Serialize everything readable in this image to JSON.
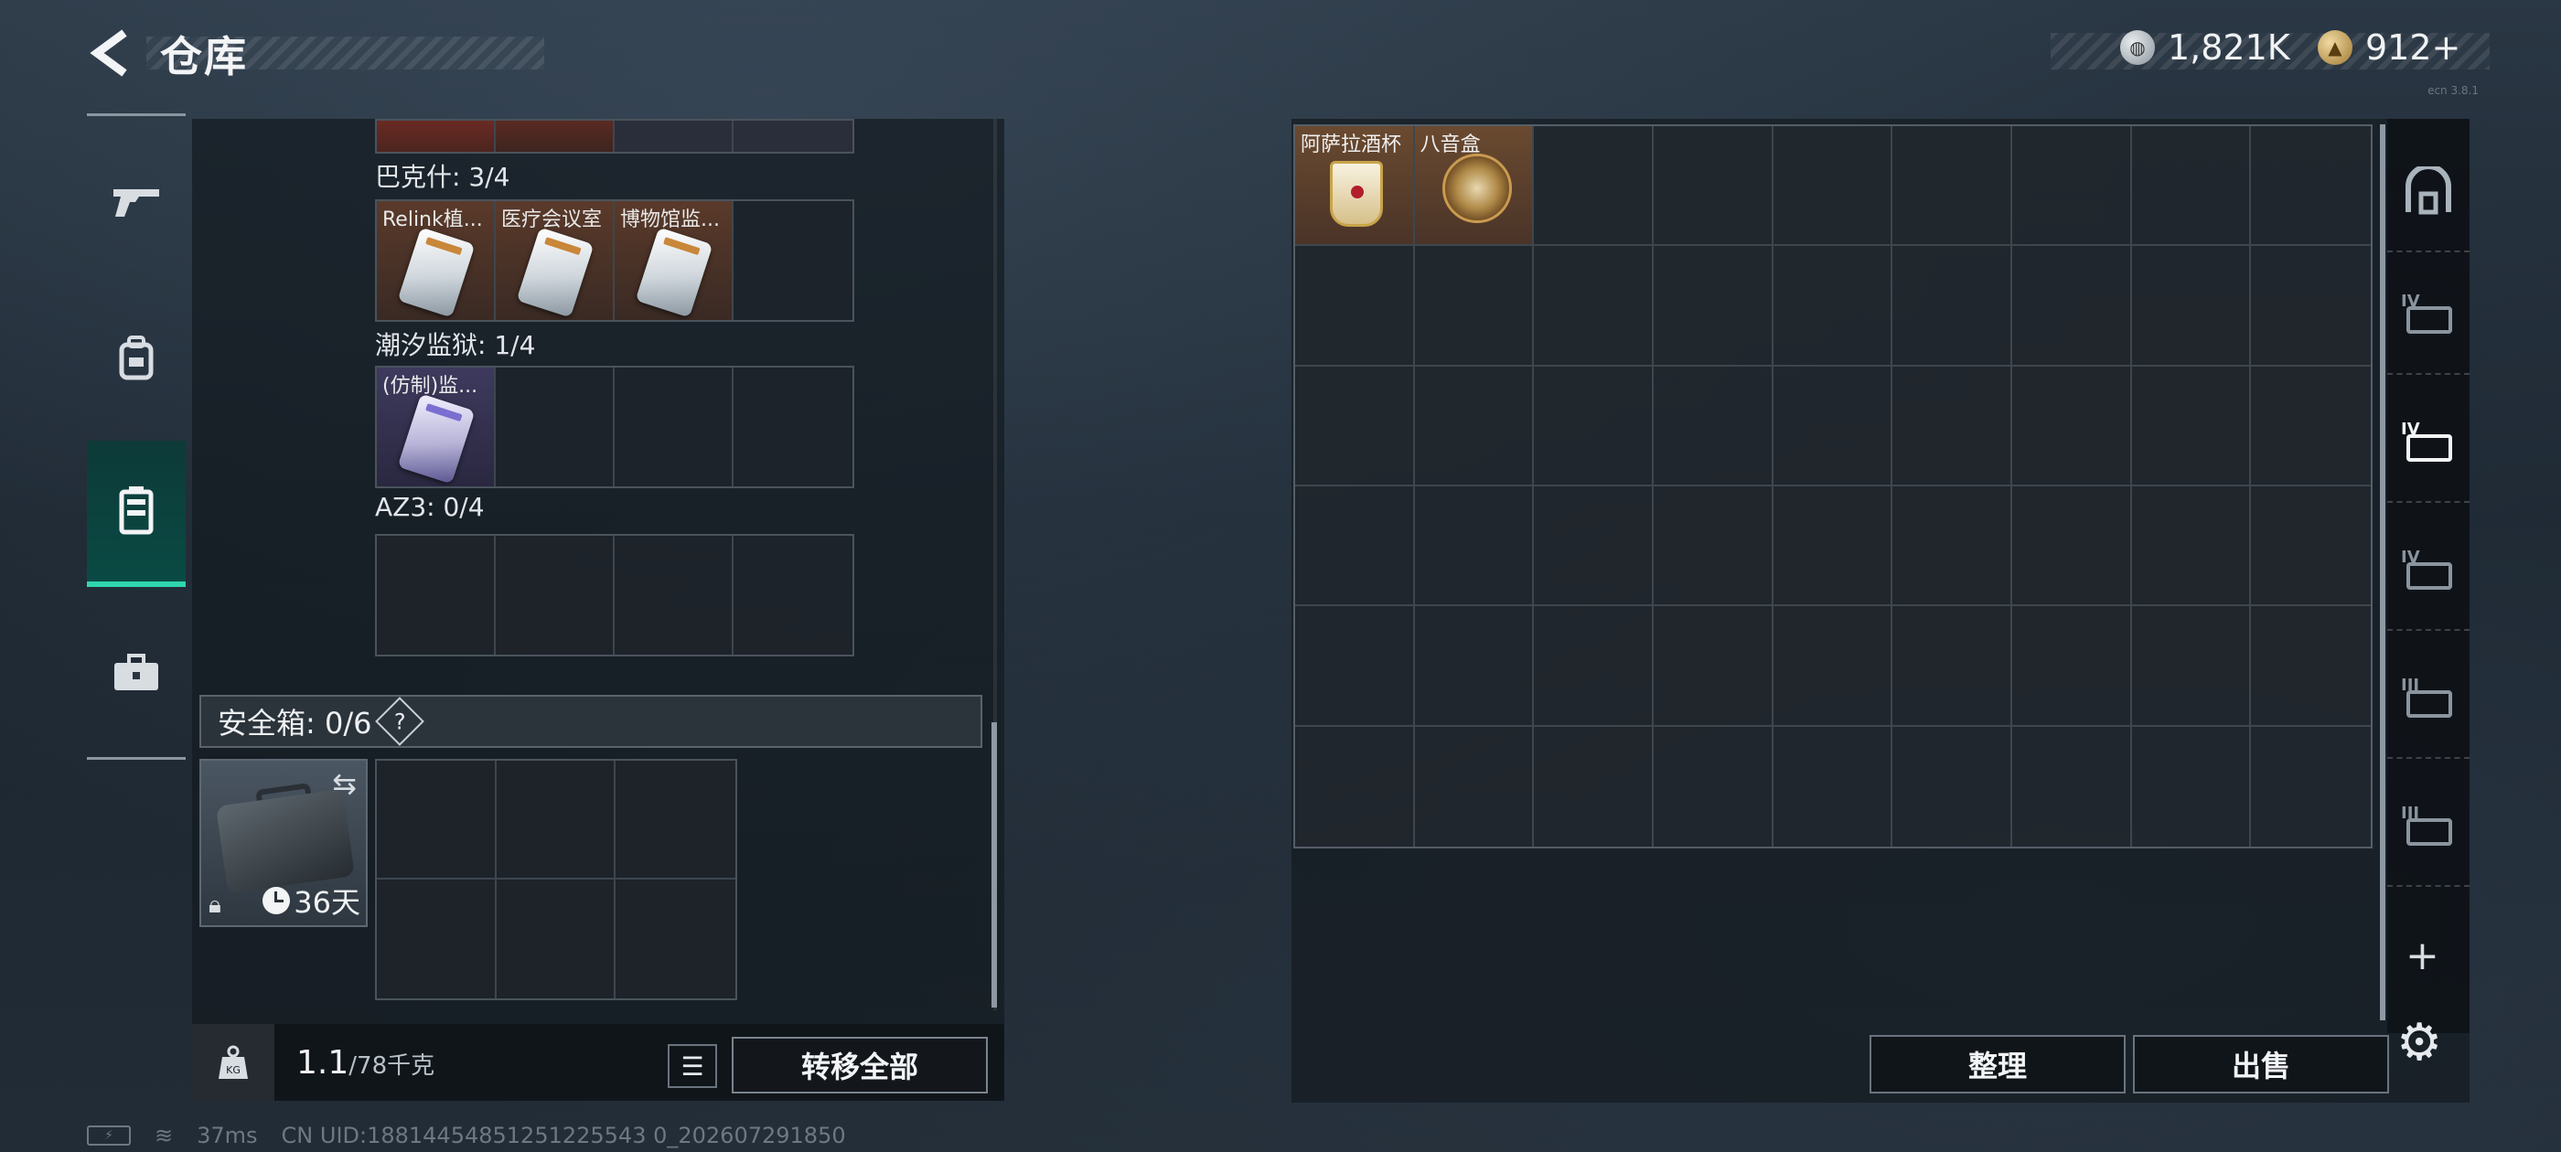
{
  "header": {
    "back_label": "<",
    "title": "仓库",
    "currency_silver": "1,821K",
    "currency_gold": "912+",
    "version": "ecn 3.8.1"
  },
  "left_nav": [
    {
      "name": "weapons",
      "icon": "gun-icon"
    },
    {
      "name": "gear",
      "icon": "backpack-icon"
    },
    {
      "name": "storage",
      "icon": "locker-icon",
      "active": true
    },
    {
      "name": "kit",
      "icon": "briefcase-icon"
    }
  ],
  "keycards": {
    "sections": [
      {
        "label": "巴克什: 3/4",
        "slots": [
          "Relink植...",
          "医疗会议室",
          "博物馆监..."
        ]
      },
      {
        "label": "潮汐监狱: 1/4",
        "slots": [
          "(仿制)监..."
        ]
      },
      {
        "label": "AZ3: 0/4",
        "slots": []
      }
    ]
  },
  "safe": {
    "label": "安全箱: 0/6",
    "help": "?",
    "timer": "36天"
  },
  "bottom": {
    "weight_value": "1.1",
    "weight_cap": "/78千克",
    "kg_label": "KG",
    "transfer_all": "转移全部"
  },
  "stash": {
    "items": [
      {
        "label": "阿萨拉酒杯"
      },
      {
        "label": "八音盒"
      }
    ],
    "cols": 9,
    "rows": 6
  },
  "side_tabs": [
    "IV",
    "IV",
    "IV",
    "III",
    "III"
  ],
  "actions": {
    "organize": "整理",
    "sell": "出售",
    "add": "+"
  },
  "status": {
    "ping": "37ms",
    "uid": "CN UID:18814454851251225543 0_202607291850"
  },
  "colors": {
    "accent": "#2fd6b0",
    "item_rare": "#5a3a2a",
    "item_epic": "#3e3a5e"
  }
}
